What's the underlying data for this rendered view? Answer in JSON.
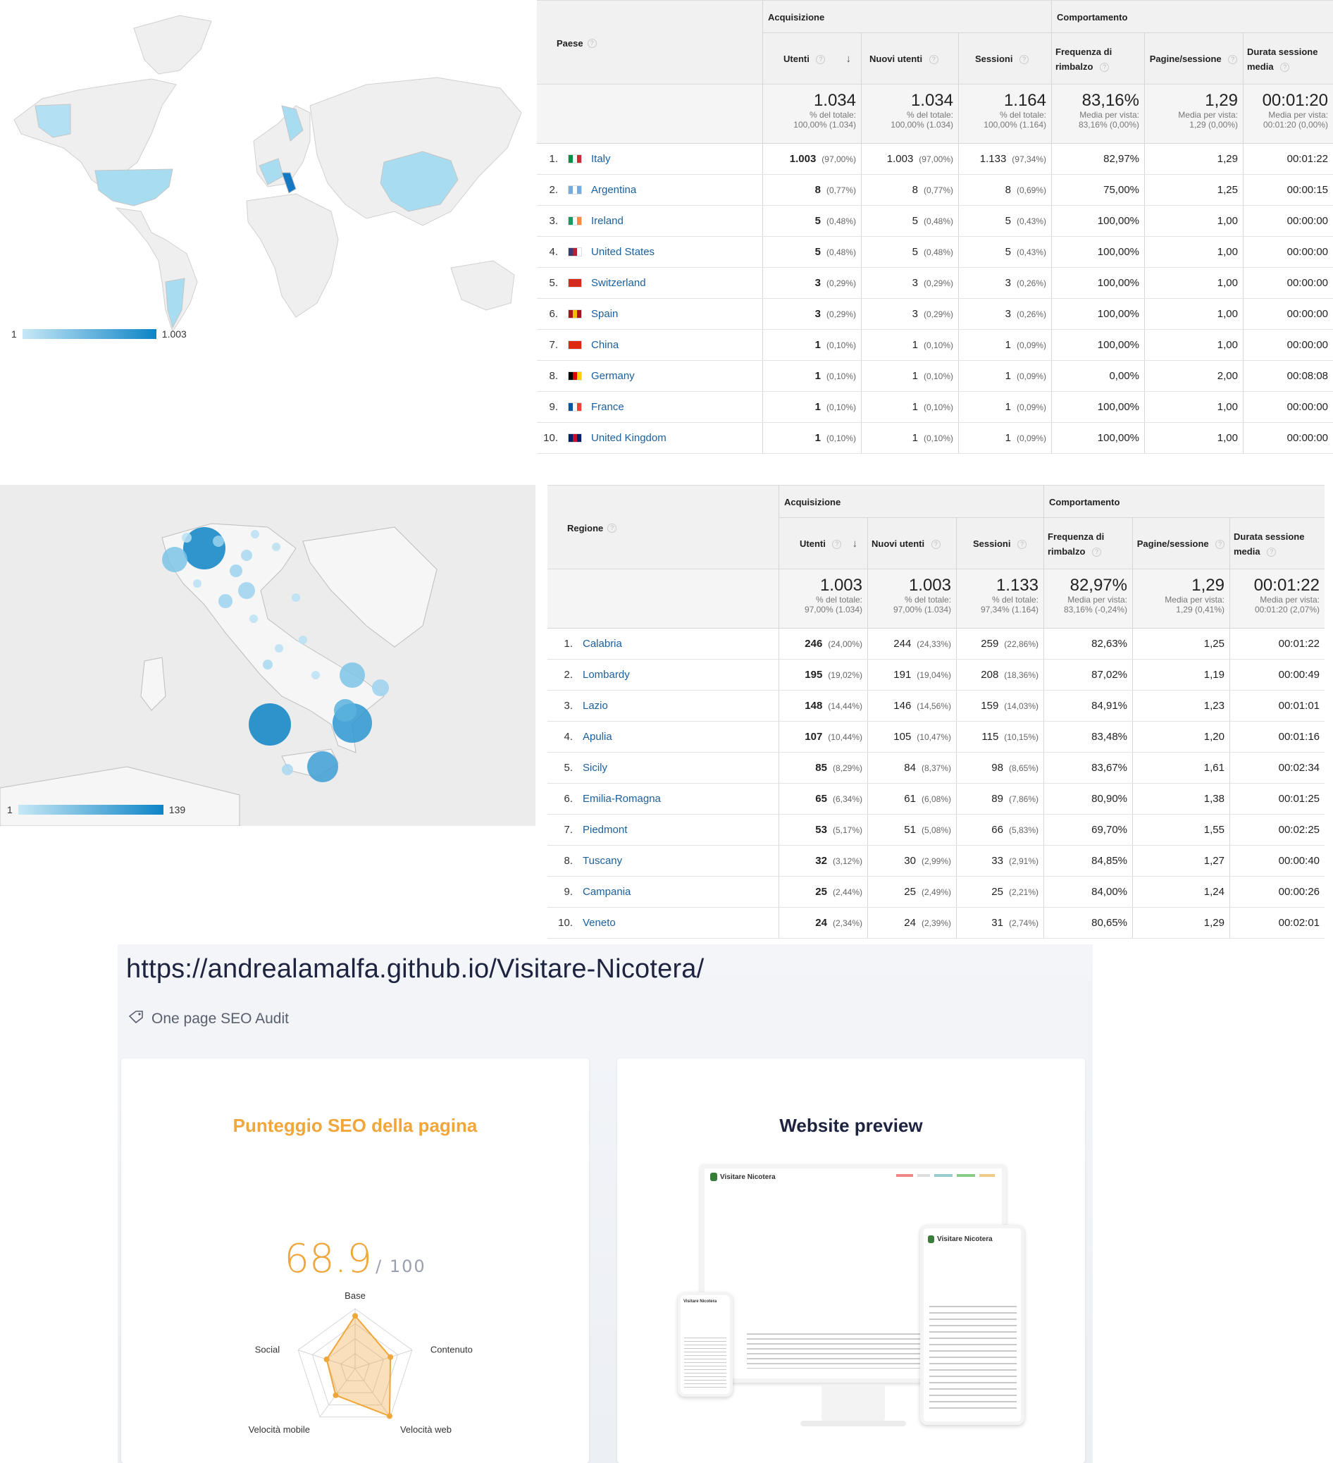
{
  "world_map": {
    "legend_min": "1",
    "legend_max": "1.003",
    "colors": {
      "low": "#c7e8f6",
      "high": "#0d84c6",
      "land": "#f3f3f3",
      "border": "#cfcfcf"
    }
  },
  "country_table": {
    "dimension_label": "Paese",
    "group_acquisition": "Acquisizione",
    "group_behavior": "Comportamento",
    "columns": [
      "Utenti",
      "Nuovi utenti",
      "Sessioni",
      "Frequenza di rimbalzo",
      "Pagine/sessione",
      "Durata sessione media"
    ],
    "totals": [
      {
        "big": "1.034",
        "l1": "% del totale:",
        "l2": "100,00% (1.034)"
      },
      {
        "big": "1.034",
        "l1": "% del totale:",
        "l2": "100,00% (1.034)"
      },
      {
        "big": "1.164",
        "l1": "% del totale:",
        "l2": "100,00% (1.164)"
      },
      {
        "big": "83,16%",
        "l1": "Media per vista:",
        "l2": "83,16% (0,00%)"
      },
      {
        "big": "1,29",
        "l1": "Media per vista:",
        "l2": "1,29 (0,00%)"
      },
      {
        "big": "00:01:20",
        "l1": "Media per vista:",
        "l2": "00:01:20 (0,00%)"
      }
    ],
    "rows": [
      {
        "idx": "1.",
        "name": "Italy",
        "flag": [
          "#009246",
          "#ffffff",
          "#ce2b37"
        ],
        "users": "1.003",
        "users_pct": "(97,00%)",
        "new": "1.003",
        "new_pct": "(97,00%)",
        "sess": "1.133",
        "sess_pct": "(97,34%)",
        "bounce": "82,97%",
        "pps": "1,29",
        "dur": "00:01:22"
      },
      {
        "idx": "2.",
        "name": "Argentina",
        "flag": [
          "#74acdf",
          "#ffffff",
          "#74acdf"
        ],
        "users": "8",
        "users_pct": "(0,77%)",
        "new": "8",
        "new_pct": "(0,77%)",
        "sess": "8",
        "sess_pct": "(0,69%)",
        "bounce": "75,00%",
        "pps": "1,25",
        "dur": "00:00:15"
      },
      {
        "idx": "3.",
        "name": "Ireland",
        "flag": [
          "#169b62",
          "#ffffff",
          "#ff883e"
        ],
        "users": "5",
        "users_pct": "(0,48%)",
        "new": "5",
        "new_pct": "(0,48%)",
        "sess": "5",
        "sess_pct": "(0,43%)",
        "bounce": "100,00%",
        "pps": "1,00",
        "dur": "00:00:00"
      },
      {
        "idx": "4.",
        "name": "United States",
        "flag": [
          "#3c3b6e",
          "#b22234",
          "#ffffff"
        ],
        "users": "5",
        "users_pct": "(0,48%)",
        "new": "5",
        "new_pct": "(0,48%)",
        "sess": "5",
        "sess_pct": "(0,43%)",
        "bounce": "100,00%",
        "pps": "1,00",
        "dur": "00:00:00"
      },
      {
        "idx": "5.",
        "name": "Switzerland",
        "flag": [
          "#d52b1e",
          "#d52b1e",
          "#d52b1e"
        ],
        "users": "3",
        "users_pct": "(0,29%)",
        "new": "3",
        "new_pct": "(0,29%)",
        "sess": "3",
        "sess_pct": "(0,26%)",
        "bounce": "100,00%",
        "pps": "1,00",
        "dur": "00:00:00"
      },
      {
        "idx": "6.",
        "name": "Spain",
        "flag": [
          "#aa151b",
          "#f1bf00",
          "#aa151b"
        ],
        "users": "3",
        "users_pct": "(0,29%)",
        "new": "3",
        "new_pct": "(0,29%)",
        "sess": "3",
        "sess_pct": "(0,26%)",
        "bounce": "100,00%",
        "pps": "1,00",
        "dur": "00:00:00"
      },
      {
        "idx": "7.",
        "name": "China",
        "flag": [
          "#de2910",
          "#de2910",
          "#de2910"
        ],
        "users": "1",
        "users_pct": "(0,10%)",
        "new": "1",
        "new_pct": "(0,10%)",
        "sess": "1",
        "sess_pct": "(0,09%)",
        "bounce": "100,00%",
        "pps": "1,00",
        "dur": "00:00:00"
      },
      {
        "idx": "8.",
        "name": "Germany",
        "flag": [
          "#000000",
          "#dd0000",
          "#ffce00"
        ],
        "users": "1",
        "users_pct": "(0,10%)",
        "new": "1",
        "new_pct": "(0,10%)",
        "sess": "1",
        "sess_pct": "(0,09%)",
        "bounce": "0,00%",
        "pps": "2,00",
        "dur": "00:08:08"
      },
      {
        "idx": "9.",
        "name": "France",
        "flag": [
          "#0055a4",
          "#ffffff",
          "#ef4135"
        ],
        "users": "1",
        "users_pct": "(0,10%)",
        "new": "1",
        "new_pct": "(0,10%)",
        "sess": "1",
        "sess_pct": "(0,09%)",
        "bounce": "100,00%",
        "pps": "1,00",
        "dur": "00:00:00"
      },
      {
        "idx": "10.",
        "name": "United Kingdom",
        "flag": [
          "#012169",
          "#c8102e",
          "#012169"
        ],
        "users": "1",
        "users_pct": "(0,10%)",
        "new": "1",
        "new_pct": "(0,10%)",
        "sess": "1",
        "sess_pct": "(0,09%)",
        "bounce": "100,00%",
        "pps": "1,00",
        "dur": "00:00:00"
      }
    ]
  },
  "italy_map": {
    "legend_min": "1",
    "legend_max": "139"
  },
  "region_table": {
    "dimension_label": "Regione",
    "group_acquisition": "Acquisizione",
    "group_behavior": "Comportamento",
    "columns": [
      "Utenti",
      "Nuovi utenti",
      "Sessioni",
      "Frequenza di rimbalzo",
      "Pagine/sessione",
      "Durata sessione media"
    ],
    "totals": [
      {
        "big": "1.003",
        "l1": "% del totale:",
        "l2": "97,00% (1.034)"
      },
      {
        "big": "1.003",
        "l1": "% del totale:",
        "l2": "97,00% (1.034)"
      },
      {
        "big": "1.133",
        "l1": "% del totale:",
        "l2": "97,34% (1.164)"
      },
      {
        "big": "82,97%",
        "l1": "Media per vista:",
        "l2": "83,16% (-0,24%)"
      },
      {
        "big": "1,29",
        "l1": "Media per vista:",
        "l2": "1,29 (0,41%)"
      },
      {
        "big": "00:01:22",
        "l1": "Media per vista:",
        "l2": "00:01:20 (2,07%)"
      }
    ],
    "rows": [
      {
        "idx": "1.",
        "name": "Calabria",
        "users": "246",
        "users_pct": "(24,00%)",
        "new": "244",
        "new_pct": "(24,33%)",
        "sess": "259",
        "sess_pct": "(22,86%)",
        "bounce": "82,63%",
        "pps": "1,25",
        "dur": "00:01:22"
      },
      {
        "idx": "2.",
        "name": "Lombardy",
        "users": "195",
        "users_pct": "(19,02%)",
        "new": "191",
        "new_pct": "(19,04%)",
        "sess": "208",
        "sess_pct": "(18,36%)",
        "bounce": "87,02%",
        "pps": "1,19",
        "dur": "00:00:49"
      },
      {
        "idx": "3.",
        "name": "Lazio",
        "users": "148",
        "users_pct": "(14,44%)",
        "new": "146",
        "new_pct": "(14,56%)",
        "sess": "159",
        "sess_pct": "(14,03%)",
        "bounce": "84,91%",
        "pps": "1,23",
        "dur": "00:01:01"
      },
      {
        "idx": "4.",
        "name": "Apulia",
        "users": "107",
        "users_pct": "(10,44%)",
        "new": "105",
        "new_pct": "(10,47%)",
        "sess": "115",
        "sess_pct": "(10,15%)",
        "bounce": "83,48%",
        "pps": "1,20",
        "dur": "00:01:16"
      },
      {
        "idx": "5.",
        "name": "Sicily",
        "users": "85",
        "users_pct": "(8,29%)",
        "new": "84",
        "new_pct": "(8,37%)",
        "sess": "98",
        "sess_pct": "(8,65%)",
        "bounce": "83,67%",
        "pps": "1,61",
        "dur": "00:02:34"
      },
      {
        "idx": "6.",
        "name": "Emilia-Romagna",
        "users": "65",
        "users_pct": "(6,34%)",
        "new": "61",
        "new_pct": "(6,08%)",
        "sess": "89",
        "sess_pct": "(7,86%)",
        "bounce": "80,90%",
        "pps": "1,38",
        "dur": "00:01:25"
      },
      {
        "idx": "7.",
        "name": "Piedmont",
        "users": "53",
        "users_pct": "(5,17%)",
        "new": "51",
        "new_pct": "(5,08%)",
        "sess": "66",
        "sess_pct": "(5,83%)",
        "bounce": "69,70%",
        "pps": "1,55",
        "dur": "00:02:25"
      },
      {
        "idx": "8.",
        "name": "Tuscany",
        "users": "32",
        "users_pct": "(3,12%)",
        "new": "30",
        "new_pct": "(2,99%)",
        "sess": "33",
        "sess_pct": "(2,91%)",
        "bounce": "84,85%",
        "pps": "1,27",
        "dur": "00:00:40"
      },
      {
        "idx": "9.",
        "name": "Campania",
        "users": "25",
        "users_pct": "(2,44%)",
        "new": "25",
        "new_pct": "(2,49%)",
        "sess": "25",
        "sess_pct": "(2,21%)",
        "bounce": "84,00%",
        "pps": "1,24",
        "dur": "00:00:26"
      },
      {
        "idx": "10.",
        "name": "Veneto",
        "users": "24",
        "users_pct": "(2,34%)",
        "new": "24",
        "new_pct": "(2,39%)",
        "sess": "31",
        "sess_pct": "(2,74%)",
        "bounce": "80,65%",
        "pps": "1,29",
        "dur": "00:02:01"
      }
    ]
  },
  "seo": {
    "url": "https://andrealamalfa.github.io/Visitare-Nicotera/",
    "subtitle": "One page SEO Audit",
    "score_card_title": "Punteggio SEO della pagina",
    "score": "68.9",
    "score_max": "/ 100",
    "radar_axes": [
      "Base",
      "Contenuto",
      "Velocità web",
      "Velocità mobile",
      "Social"
    ],
    "radar_values": [
      0.88,
      0.62,
      0.98,
      0.55,
      0.5
    ],
    "preview_card_title": "Website preview",
    "preview_site_name": "Visitare Nicotera",
    "accent": "#f0a63a"
  }
}
